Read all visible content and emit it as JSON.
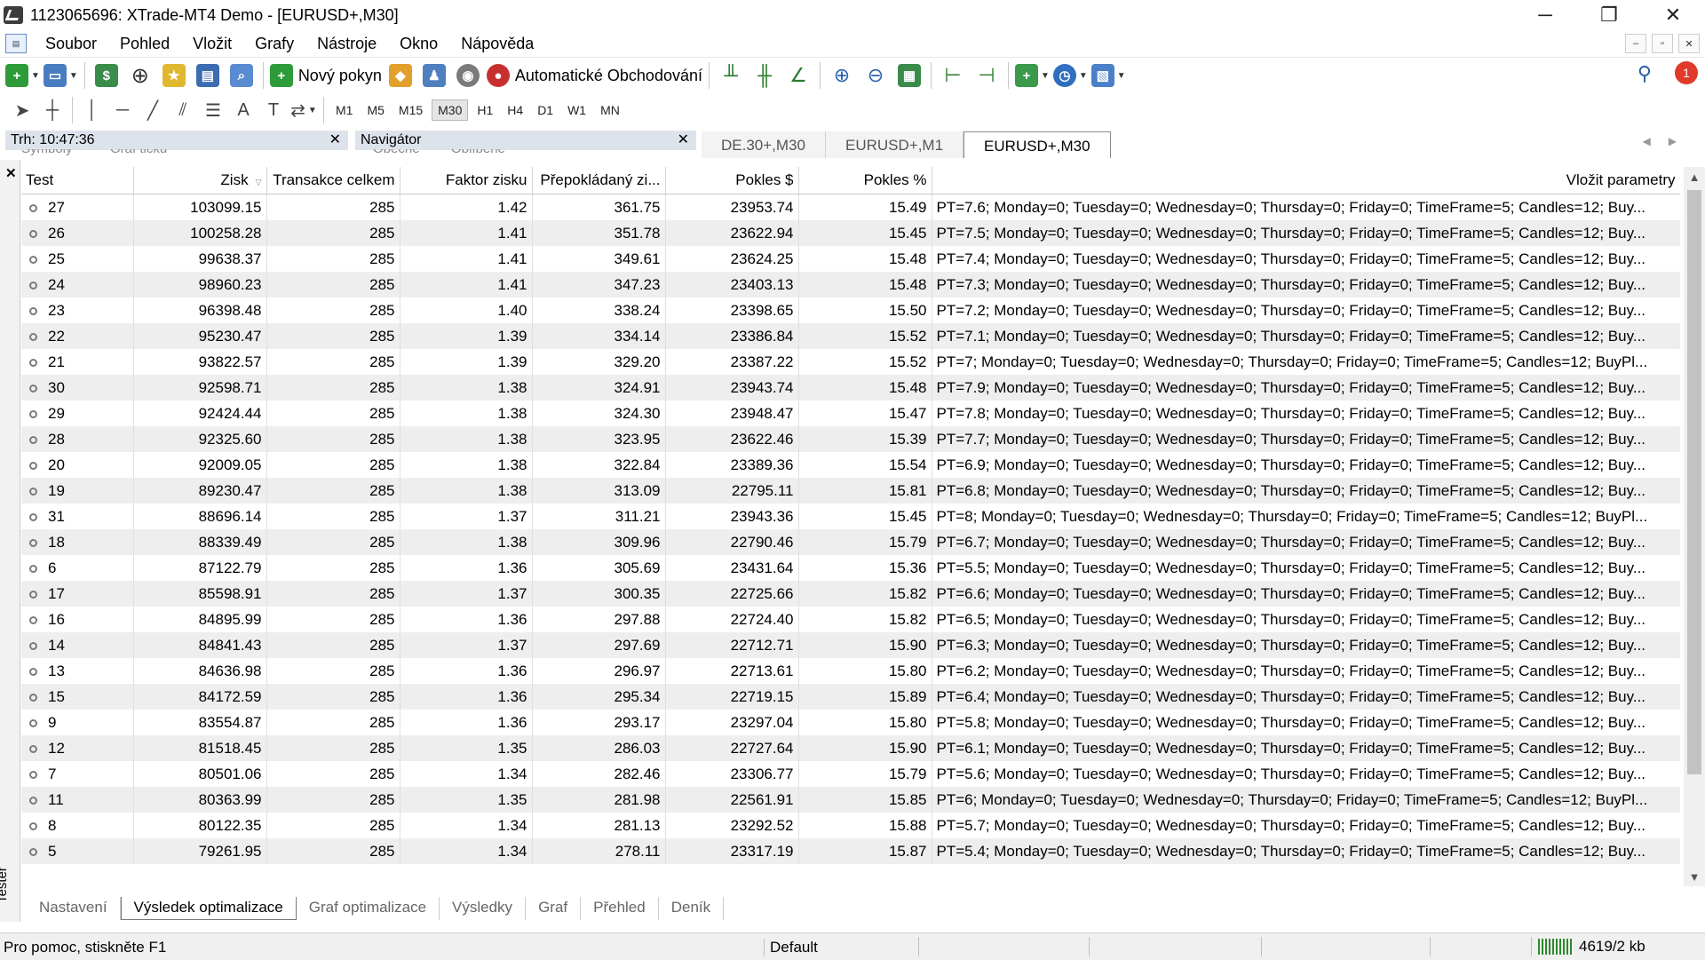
{
  "window": {
    "title": "1123065696: XTrade-MT4 Demo - [EURUSD+,M30]",
    "minimize": "─",
    "restore": "❐",
    "close": "✕"
  },
  "menu": {
    "items": [
      "Soubor",
      "Pohled",
      "Vložit",
      "Grafy",
      "Nástroje",
      "Okno",
      "Nápověda"
    ]
  },
  "toolbar": {
    "new_order": "Nový pokyn",
    "auto_trading": "Automatické Obchodování",
    "notification_count": "1"
  },
  "timeframes": [
    "M1",
    "M5",
    "M15",
    "M30",
    "H1",
    "H4",
    "D1",
    "W1",
    "MN"
  ],
  "active_timeframe": "M30",
  "panels": {
    "market_watch_title": "Trh: 10:47:36",
    "market_watch_tabs": [
      "Symboly",
      "Graf ticku"
    ],
    "navigator_title": "Navigátor",
    "navigator_tabs": [
      "Obecné",
      "Oblíbené"
    ]
  },
  "chart_tabs": [
    "DE.30+,M30",
    "EURUSD+,M1",
    "EURUSD+,M30"
  ],
  "active_chart_tab": "EURUSD+,M30",
  "tester": {
    "side_label": "Tester",
    "columns": [
      "Test",
      "Zisk",
      "Transakce celkem",
      "Faktor zisku",
      "Přepokládaný zi...",
      "Pokles $",
      "Pokles %",
      "Vložit parametry"
    ],
    "rows": [
      [
        "27",
        "103099.15",
        "285",
        "1.42",
        "361.75",
        "23953.74",
        "15.49",
        "PT=7.6; Monday=0; Tuesday=0; Wednesday=0; Thursday=0; Friday=0; TimeFrame=5; Candles=12; Buy..."
      ],
      [
        "26",
        "100258.28",
        "285",
        "1.41",
        "351.78",
        "23622.94",
        "15.45",
        "PT=7.5; Monday=0; Tuesday=0; Wednesday=0; Thursday=0; Friday=0; TimeFrame=5; Candles=12; Buy..."
      ],
      [
        "25",
        "99638.37",
        "285",
        "1.41",
        "349.61",
        "23624.25",
        "15.48",
        "PT=7.4; Monday=0; Tuesday=0; Wednesday=0; Thursday=0; Friday=0; TimeFrame=5; Candles=12; Buy..."
      ],
      [
        "24",
        "98960.23",
        "285",
        "1.41",
        "347.23",
        "23403.13",
        "15.48",
        "PT=7.3; Monday=0; Tuesday=0; Wednesday=0; Thursday=0; Friday=0; TimeFrame=5; Candles=12; Buy..."
      ],
      [
        "23",
        "96398.48",
        "285",
        "1.40",
        "338.24",
        "23398.65",
        "15.50",
        "PT=7.2; Monday=0; Tuesday=0; Wednesday=0; Thursday=0; Friday=0; TimeFrame=5; Candles=12; Buy..."
      ],
      [
        "22",
        "95230.47",
        "285",
        "1.39",
        "334.14",
        "23386.84",
        "15.52",
        "PT=7.1; Monday=0; Tuesday=0; Wednesday=0; Thursday=0; Friday=0; TimeFrame=5; Candles=12; Buy..."
      ],
      [
        "21",
        "93822.57",
        "285",
        "1.39",
        "329.20",
        "23387.22",
        "15.52",
        "PT=7; Monday=0; Tuesday=0; Wednesday=0; Thursday=0; Friday=0; TimeFrame=5; Candles=12; BuyPl..."
      ],
      [
        "30",
        "92598.71",
        "285",
        "1.38",
        "324.91",
        "23943.74",
        "15.48",
        "PT=7.9; Monday=0; Tuesday=0; Wednesday=0; Thursday=0; Friday=0; TimeFrame=5; Candles=12; Buy..."
      ],
      [
        "29",
        "92424.44",
        "285",
        "1.38",
        "324.30",
        "23948.47",
        "15.47",
        "PT=7.8; Monday=0; Tuesday=0; Wednesday=0; Thursday=0; Friday=0; TimeFrame=5; Candles=12; Buy..."
      ],
      [
        "28",
        "92325.60",
        "285",
        "1.38",
        "323.95",
        "23622.46",
        "15.39",
        "PT=7.7; Monday=0; Tuesday=0; Wednesday=0; Thursday=0; Friday=0; TimeFrame=5; Candles=12; Buy..."
      ],
      [
        "20",
        "92009.05",
        "285",
        "1.38",
        "322.84",
        "23389.36",
        "15.54",
        "PT=6.9; Monday=0; Tuesday=0; Wednesday=0; Thursday=0; Friday=0; TimeFrame=5; Candles=12; Buy..."
      ],
      [
        "19",
        "89230.47",
        "285",
        "1.38",
        "313.09",
        "22795.11",
        "15.81",
        "PT=6.8; Monday=0; Tuesday=0; Wednesday=0; Thursday=0; Friday=0; TimeFrame=5; Candles=12; Buy..."
      ],
      [
        "31",
        "88696.14",
        "285",
        "1.37",
        "311.21",
        "23943.36",
        "15.45",
        "PT=8; Monday=0; Tuesday=0; Wednesday=0; Thursday=0; Friday=0; TimeFrame=5; Candles=12; BuyPl..."
      ],
      [
        "18",
        "88339.49",
        "285",
        "1.38",
        "309.96",
        "22790.46",
        "15.79",
        "PT=6.7; Monday=0; Tuesday=0; Wednesday=0; Thursday=0; Friday=0; TimeFrame=5; Candles=12; Buy..."
      ],
      [
        "6",
        "87122.79",
        "285",
        "1.36",
        "305.69",
        "23431.64",
        "15.36",
        "PT=5.5; Monday=0; Tuesday=0; Wednesday=0; Thursday=0; Friday=0; TimeFrame=5; Candles=12; Buy..."
      ],
      [
        "17",
        "85598.91",
        "285",
        "1.37",
        "300.35",
        "22725.66",
        "15.82",
        "PT=6.6; Monday=0; Tuesday=0; Wednesday=0; Thursday=0; Friday=0; TimeFrame=5; Candles=12; Buy..."
      ],
      [
        "16",
        "84895.99",
        "285",
        "1.36",
        "297.88",
        "22724.40",
        "15.82",
        "PT=6.5; Monday=0; Tuesday=0; Wednesday=0; Thursday=0; Friday=0; TimeFrame=5; Candles=12; Buy..."
      ],
      [
        "14",
        "84841.43",
        "285",
        "1.37",
        "297.69",
        "22712.71",
        "15.90",
        "PT=6.3; Monday=0; Tuesday=0; Wednesday=0; Thursday=0; Friday=0; TimeFrame=5; Candles=12; Buy..."
      ],
      [
        "13",
        "84636.98",
        "285",
        "1.36",
        "296.97",
        "22713.61",
        "15.80",
        "PT=6.2; Monday=0; Tuesday=0; Wednesday=0; Thursday=0; Friday=0; TimeFrame=5; Candles=12; Buy..."
      ],
      [
        "15",
        "84172.59",
        "285",
        "1.36",
        "295.34",
        "22719.15",
        "15.89",
        "PT=6.4; Monday=0; Tuesday=0; Wednesday=0; Thursday=0; Friday=0; TimeFrame=5; Candles=12; Buy..."
      ],
      [
        "9",
        "83554.87",
        "285",
        "1.36",
        "293.17",
        "23297.04",
        "15.80",
        "PT=5.8; Monday=0; Tuesday=0; Wednesday=0; Thursday=0; Friday=0; TimeFrame=5; Candles=12; Buy..."
      ],
      [
        "12",
        "81518.45",
        "285",
        "1.35",
        "286.03",
        "22727.64",
        "15.90",
        "PT=6.1; Monday=0; Tuesday=0; Wednesday=0; Thursday=0; Friday=0; TimeFrame=5; Candles=12; Buy..."
      ],
      [
        "7",
        "80501.06",
        "285",
        "1.34",
        "282.46",
        "23306.77",
        "15.79",
        "PT=5.6; Monday=0; Tuesday=0; Wednesday=0; Thursday=0; Friday=0; TimeFrame=5; Candles=12; Buy..."
      ],
      [
        "11",
        "80363.99",
        "285",
        "1.35",
        "281.98",
        "22561.91",
        "15.85",
        "PT=6; Monday=0; Tuesday=0; Wednesday=0; Thursday=0; Friday=0; TimeFrame=5; Candles=12; BuyPl..."
      ],
      [
        "8",
        "80122.35",
        "285",
        "1.34",
        "281.13",
        "23292.52",
        "15.88",
        "PT=5.7; Monday=0; Tuesday=0; Wednesday=0; Thursday=0; Friday=0; TimeFrame=5; Candles=12; Buy..."
      ],
      [
        "5",
        "79261.95",
        "285",
        "1.34",
        "278.11",
        "23317.19",
        "15.87",
        "PT=5.4; Monday=0; Tuesday=0; Wednesday=0; Thursday=0; Friday=0; TimeFrame=5; Candles=12; Buy..."
      ]
    ],
    "tabs": [
      "Nastavení",
      "Výsledek optimalizace",
      "Graf optimalizace",
      "Výsledky",
      "Graf",
      "Přehled",
      "Deník"
    ],
    "active_tab": "Výsledek optimalizace"
  },
  "status": {
    "help": "Pro pomoc, stiskněte F1",
    "profile": "Default",
    "connection": "4619/2 kb"
  }
}
